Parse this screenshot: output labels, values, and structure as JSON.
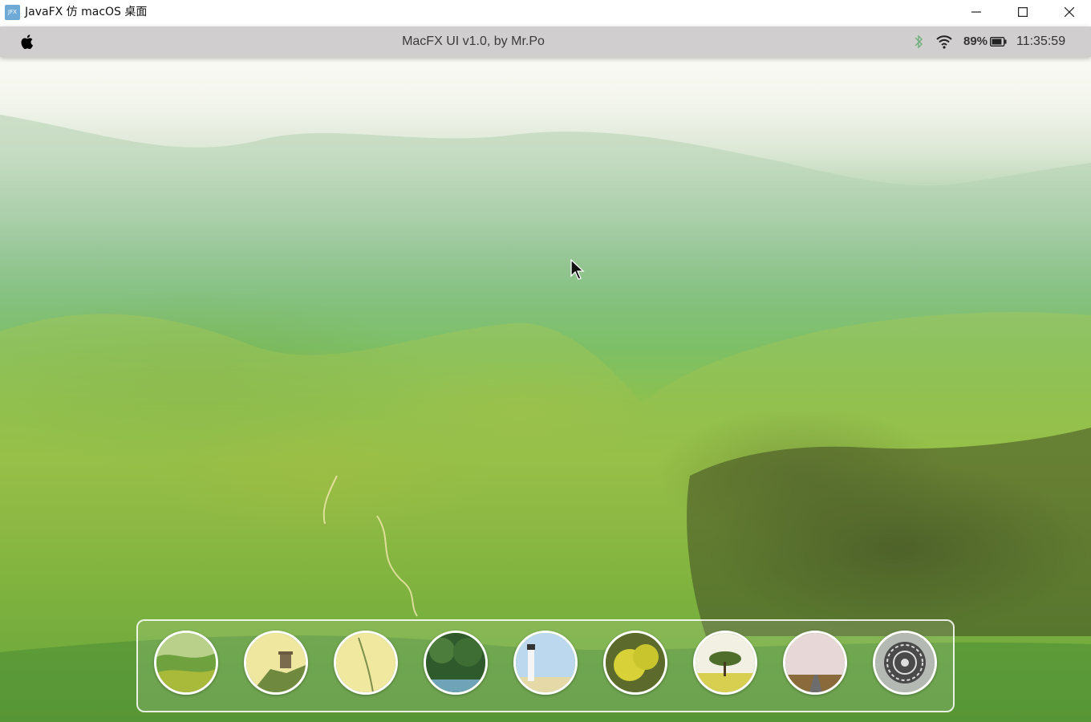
{
  "window": {
    "icon_text": "JFX",
    "title": "JavaFX 仿 macOS 桌面",
    "controls": [
      "minimize-icon",
      "maximize-icon",
      "close-icon"
    ]
  },
  "menubar": {
    "logo_icon": "apple-icon",
    "title": "MacFX UI v1.0, by Mr.Po",
    "status": {
      "bluetooth_icon": "bluetooth-icon",
      "wifi_icon": "wifi-icon",
      "battery_percent": "89%",
      "battery_level": 0.89,
      "battery_icon": "battery-icon",
      "time": "11:35:59"
    }
  },
  "desktop": {
    "wallpaper": "green terraced mountain valley with mist",
    "cursor_icon": "arrow-cursor-icon"
  },
  "dock": {
    "items": [
      {
        "name": "valley-landscape",
        "icon": "valley-icon"
      },
      {
        "name": "great-wall",
        "icon": "great-wall-icon"
      },
      {
        "name": "leaf-closeup",
        "icon": "leaf-icon"
      },
      {
        "name": "forest-stream",
        "icon": "forest-icon"
      },
      {
        "name": "lighthouse",
        "icon": "lighthouse-icon"
      },
      {
        "name": "yellow-tree",
        "icon": "yellow-tree-icon"
      },
      {
        "name": "lone-tree-field",
        "icon": "lone-tree-icon"
      },
      {
        "name": "road-horizon",
        "icon": "road-icon"
      },
      {
        "name": "system-settings",
        "icon": "gear-icon"
      }
    ]
  }
}
